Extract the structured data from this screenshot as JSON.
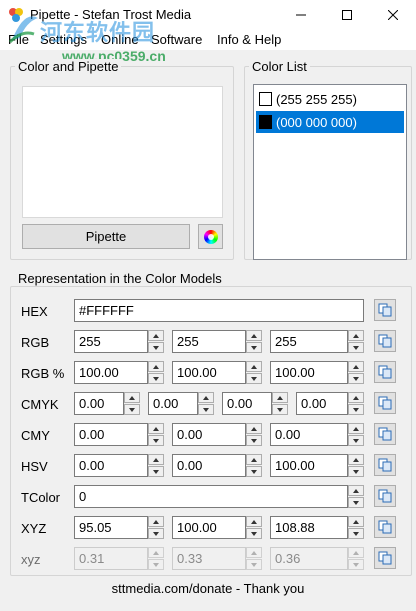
{
  "window": {
    "title": "Pipette - Stefan Trost Media",
    "minimize_icon": "minimize-icon",
    "maximize_icon": "maximize-icon",
    "close_icon": "close-icon"
  },
  "watermark": {
    "title": "河东软件园",
    "url": "www.pc0359.cn"
  },
  "menu": {
    "items": [
      "File",
      "Settings",
      "Online",
      "Software",
      "Info & Help"
    ]
  },
  "color_and_pipette": {
    "label": "Color and Pipette",
    "preview_color": "#FFFFFF",
    "pipette_button": "Pipette",
    "color_wheel_icon": "color-wheel-icon"
  },
  "color_list": {
    "label": "Color List",
    "items": [
      {
        "text": "(255 255 255)",
        "swatch": "#FFFFFF",
        "selected": false
      },
      {
        "text": "(000 000 000)",
        "swatch": "#000000",
        "selected": true
      }
    ]
  },
  "models": {
    "label": "Representation in the Color Models",
    "hex": {
      "label": "HEX",
      "value": "#FFFFFF"
    },
    "rgb": {
      "label": "RGB",
      "values": [
        "255",
        "255",
        "255"
      ]
    },
    "rgb_pct": {
      "label": "RGB %",
      "values": [
        "100.00",
        "100.00",
        "100.00"
      ]
    },
    "cmyk": {
      "label": "CMYK",
      "values": [
        "0.00",
        "0.00",
        "0.00",
        "0.00"
      ]
    },
    "cmy": {
      "label": "CMY",
      "values": [
        "0.00",
        "0.00",
        "0.00"
      ]
    },
    "hsv": {
      "label": "HSV",
      "values": [
        "0.00",
        "0.00",
        "100.00"
      ]
    },
    "tcolor": {
      "label": "TColor",
      "value": "0"
    },
    "xyz": {
      "label": "XYZ",
      "values": [
        "95.05",
        "100.00",
        "108.88"
      ]
    },
    "xyz_small": {
      "label": "xyz",
      "values": [
        "0.31",
        "0.33",
        "0.36"
      ]
    },
    "copy_icon": "copy-icon"
  },
  "footer": {
    "text": "sttmedia.com/donate - Thank you"
  },
  "colors": {
    "selection": "#0078d7",
    "window_bg": "#f0f0f0"
  }
}
